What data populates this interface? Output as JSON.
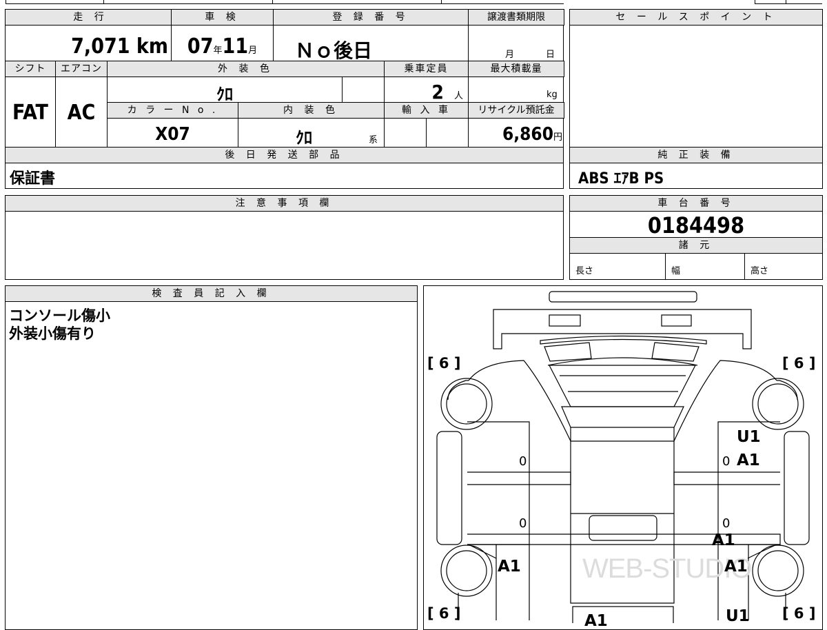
{
  "spec": {
    "headers": {
      "mileage": "走 行",
      "inspection": "車 検",
      "registration": "登 録 番 号",
      "transfer_deadline": "譲渡書類期限",
      "shift": "シフト",
      "aircon": "エアコン",
      "exterior_color": "外 装 色",
      "capacity": "乗車定員",
      "max_load": "最大積載量",
      "color_no": "カ ラ ー N o .",
      "interior_color": "内 装 色",
      "import": "輸 入 車",
      "recycle": "リサイクル預託金"
    },
    "mileage_value": "7,071",
    "mileage_unit": "km",
    "inspection_year": "07",
    "year_unit": "年",
    "inspection_month": "11",
    "month_unit": "月",
    "registration_value": "Ｎｏ後日",
    "deadline_month_unit": "月",
    "deadline_day_unit": "日",
    "shift_value": "FAT",
    "aircon_value": "AC",
    "exterior_color_value": "ｸﾛ",
    "capacity_value": "2",
    "capacity_unit": "人",
    "max_load_unit": "kg",
    "color_no_value": "X07",
    "interior_color_value": "ｸﾛ",
    "interior_suffix": "系",
    "recycle_value": "6,860",
    "recycle_unit": "円"
  },
  "sales_point": {
    "header": "セ ー ル ス ポ イ ン ト"
  },
  "later_parts": {
    "header": "後 日 発 送 部 品",
    "value": "保証書"
  },
  "genuine_equipment": {
    "header": "純 正 装 備",
    "value": "ABS ｴｱB PS"
  },
  "notes": {
    "header": "注 意 事 項 欄"
  },
  "chassis": {
    "header": "車 台 番 号",
    "value": "0184498",
    "dims_header": "諸 元",
    "length": "長さ",
    "width": "幅",
    "height": "高さ"
  },
  "inspector": {
    "header": "検 査 員 記 入 欄",
    "line1": "コンソール傷小",
    "line2": "外装小傷有り"
  },
  "diagram": {
    "tire_tl": "[ 6 ]",
    "tire_tr": "[ 6 ]",
    "tire_bl": "[ 6 ]",
    "tire_br": "[ 6 ]",
    "zero_left_upper": "0",
    "zero_right_upper": "0",
    "zero_left_lower": "0",
    "zero_right_lower": "0",
    "mark_u1_top": "U1",
    "mark_a1_right_door": "A1",
    "mark_a1_right_sill": "A1",
    "mark_a1_left_rear": "A1",
    "mark_a1_right_rear": "A1",
    "mark_a1_trunk": "A1",
    "mark_u1_bottom": "U1",
    "watermark": "WEB-STUDIO"
  }
}
